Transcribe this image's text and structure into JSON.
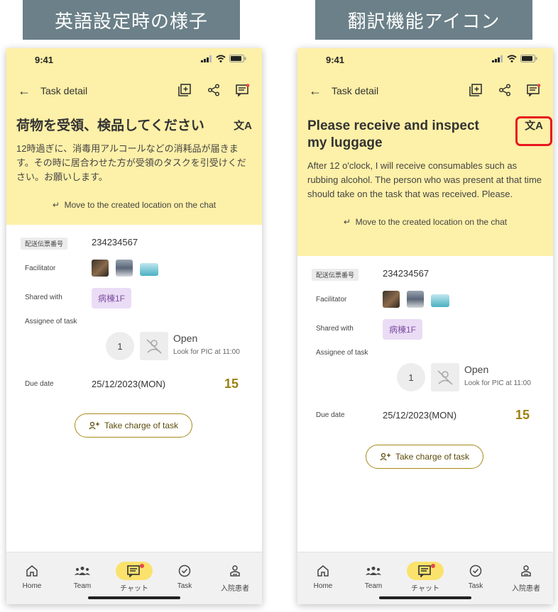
{
  "captions": {
    "left": "英語設定時の様子",
    "right": "翻訳機能アイコン"
  },
  "status": {
    "time": "9:41"
  },
  "header": {
    "title": "Task detail"
  },
  "left": {
    "task_title": "荷物を受領、検品してください",
    "description": "12時過ぎに、消毒用アルコールなどの消耗品が届きます。その時に居合わせた方が受領のタスクを引受けください。お願いします。",
    "move_link": "Move to the created location on the chat"
  },
  "right": {
    "task_title": "Please receive and inspect my luggage",
    "description": "After 12 o'clock, I will receive consumables such as rubbing alcohol. The person who was present at that time should take on the task that was received. Please.",
    "move_link": "Move to the created location on the chat"
  },
  "details": {
    "slip_label": "配送伝票番号",
    "slip_value": "234234567",
    "facilitator_label": "Facilitator",
    "shared_label": "Shared with",
    "shared_chip": "病棟1F",
    "assignee_label": "Assignee of task",
    "assignee_count": "1",
    "open_title": "Open",
    "open_sub": "Look for PIC at 11:00",
    "due_label": "Due date",
    "due_value": "25/12/2023(MON)",
    "due_number": "15",
    "take_button": "Take charge of task"
  },
  "nav": {
    "items": [
      {
        "label": "Home",
        "icon": "home-icon"
      },
      {
        "label": "Team",
        "icon": "team-icon"
      },
      {
        "label": "チャット",
        "icon": "chat-icon"
      },
      {
        "label": "Task",
        "icon": "task-check-icon"
      },
      {
        "label": "入院患者",
        "icon": "patient-icon"
      }
    ]
  },
  "colors": {
    "yellow_bg": "#fdf0a8",
    "caption_bg": "#6b8088",
    "highlight": "#e8161e",
    "accent_gold": "#9a8111",
    "chip_purple": "#eadcf5"
  }
}
